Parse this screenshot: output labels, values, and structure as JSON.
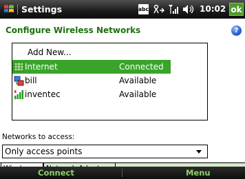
{
  "titlebar": {
    "title": "Settings",
    "ime": "abc",
    "clock": "10:02",
    "ok": "ok"
  },
  "header": {
    "page_title": "Configure Wireless Networks",
    "help": "?"
  },
  "networks": {
    "add_new": "Add New...",
    "items": [
      {
        "name": "Internet",
        "status": "Connected",
        "icon": "network-internet-icon"
      },
      {
        "name": "bill",
        "status": "Available",
        "icon": "network-adhoc-icon"
      },
      {
        "name": "inventec",
        "status": "Available",
        "icon": "signal-bars-icon"
      }
    ]
  },
  "access": {
    "label": "Networks to access:",
    "selected": "Only access points"
  },
  "tabs": [
    "Wireless",
    "Network Adapters"
  ],
  "softkeys": {
    "left": "Connect",
    "right": "Menu"
  },
  "colors": {
    "accent": "#38a52a",
    "title_green": "#1e6f0f"
  }
}
